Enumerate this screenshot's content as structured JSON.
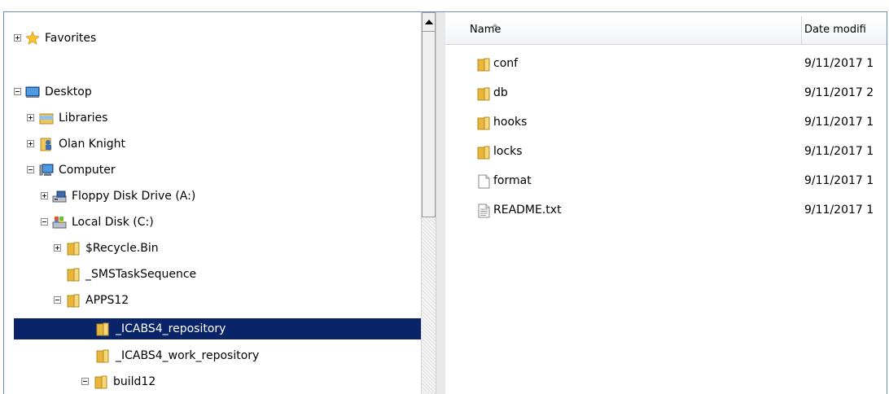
{
  "tree": {
    "items": [
      {
        "label": "Favorites",
        "icon": "star-icon",
        "expander": "plus"
      },
      {
        "label": "Desktop",
        "icon": "desktop-icon",
        "expander": "minus"
      },
      {
        "label": "Libraries",
        "icon": "libraries-icon",
        "expander": "plus"
      },
      {
        "label": "Olan Knight",
        "icon": "user-folder-icon",
        "expander": "plus"
      },
      {
        "label": "Computer",
        "icon": "computer-icon",
        "expander": "minus"
      },
      {
        "label": "Floppy Disk Drive (A:)",
        "icon": "floppy-drive-icon",
        "expander": "plus"
      },
      {
        "label": "Local Disk (C:)",
        "icon": "local-disk-icon",
        "expander": "minus"
      },
      {
        "label": "$Recycle.Bin",
        "icon": "folder-icon",
        "expander": "plus"
      },
      {
        "label": "_SMSTaskSequence",
        "icon": "folder-icon",
        "expander": ""
      },
      {
        "label": "APPS12",
        "icon": "folder-icon",
        "expander": "minus"
      },
      {
        "label": "_ICABS4_repository",
        "icon": "folder-icon",
        "expander": "",
        "selected": true
      },
      {
        "label": "_ICABS4_work_repository",
        "icon": "folder-icon",
        "expander": ""
      },
      {
        "label": "build12",
        "icon": "folder-icon",
        "expander": "minus"
      }
    ]
  },
  "list": {
    "columns": {
      "name": "Name",
      "date": "Date modifi"
    },
    "files": [
      {
        "name": "conf",
        "date": "9/11/2017 1",
        "icon": "folder-icon"
      },
      {
        "name": "db",
        "date": "9/11/2017 2",
        "icon": "folder-icon"
      },
      {
        "name": "hooks",
        "date": "9/11/2017 1",
        "icon": "folder-icon"
      },
      {
        "name": "locks",
        "date": "9/11/2017 1",
        "icon": "folder-icon"
      },
      {
        "name": "format",
        "date": "9/11/2017 1",
        "icon": "file-icon"
      },
      {
        "name": "README.txt",
        "date": "9/11/2017 1",
        "icon": "text-file-icon"
      }
    ]
  },
  "colors": {
    "selection": "#0a246a",
    "frame_border": "#6d8bbd",
    "folder": "#e8b73a"
  }
}
